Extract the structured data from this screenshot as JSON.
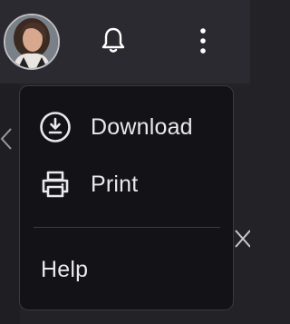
{
  "header": {
    "avatar_icon": "user-avatar",
    "notifications_icon": "bell-icon",
    "more_icon": "more-vertical-icon"
  },
  "menu": {
    "items": [
      {
        "label": "Download",
        "icon": "download-icon"
      },
      {
        "label": "Print",
        "icon": "printer-icon"
      }
    ],
    "help": {
      "label": "Help"
    }
  },
  "colors": {
    "topbar": "#2b2a31",
    "menu_bg": "#131217",
    "menu_text": "#e9e8ed",
    "divider": "#3d3c43"
  }
}
